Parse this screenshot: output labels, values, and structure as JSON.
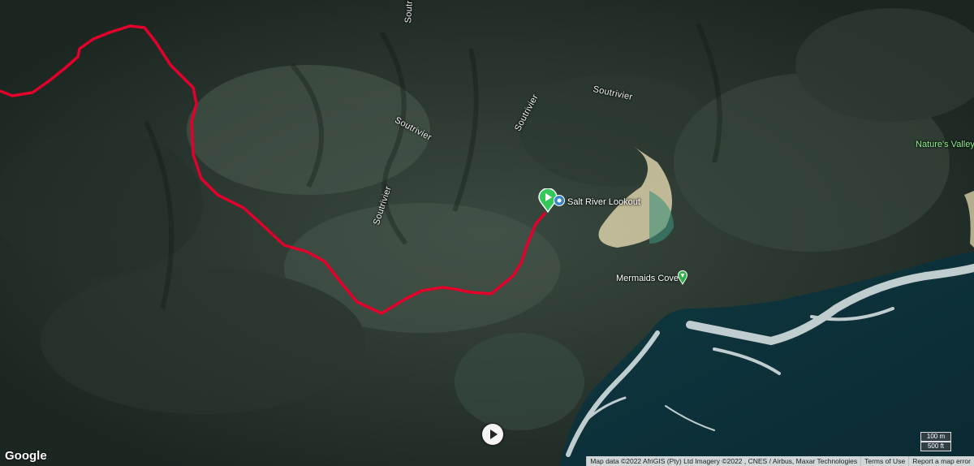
{
  "map": {
    "route_color": "#e3002b",
    "start_marker_color": "#34c759",
    "places": {
      "salt_river_lookout": "Salt River Lookout",
      "mermaids_cove": "Mermaids Cove",
      "natures_valley": "Nature's Valley"
    },
    "rivers": [
      "Soutrivier",
      "Soutrivier",
      "Soutrivier",
      "Soutrivier",
      "Soutrivier"
    ],
    "logo": "Google",
    "scale": {
      "metric": "100 m",
      "imperial": "500 ft"
    },
    "attribution": {
      "map_data": "Map data ©2022 AfriGIS (Pty) Ltd Imagery ©2022 , CNES / Airbus, Maxar Technologies",
      "terms": "Terms of Use",
      "report": "Report a map error"
    },
    "icons": {
      "start": "play-icon",
      "lookout": "viewpoint-icon",
      "cove": "place-pin-icon",
      "media": "play-button-icon"
    }
  }
}
